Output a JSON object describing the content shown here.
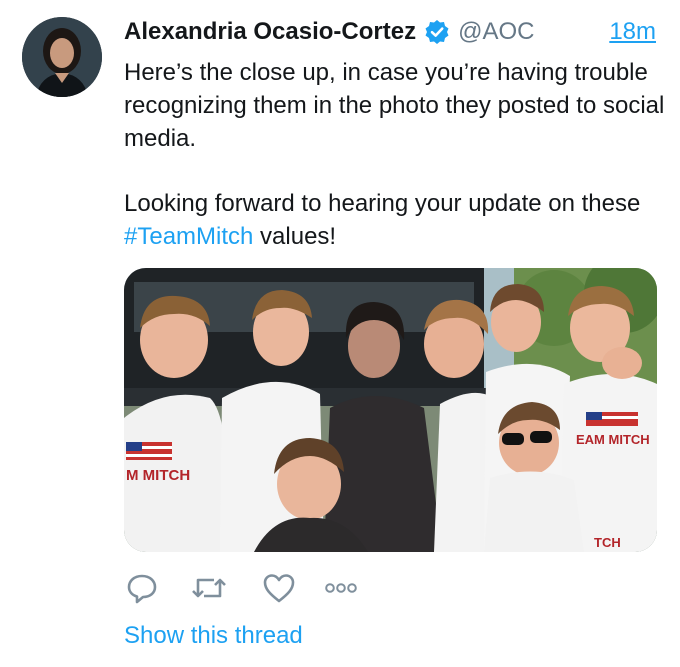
{
  "tweet": {
    "author_name": "Alexandria Ocasio-Cortez",
    "handle": "@AOC",
    "timestamp": "18m",
    "text_line1": "Here’s the close up, in case you’re having trouble recognizing them in the photo they posted to social media.",
    "text_line2_before": "Looking forward to hearing your update on these ",
    "hashtag": "#TeamMitch",
    "text_line2_after": " values!",
    "photo_shirt_text_1": "M MITCH",
    "photo_shirt_text_2": "EAM MITCH",
    "photo_shirt_text_3": "TCH"
  },
  "actions": {
    "reply_icon": "reply-icon",
    "retweet_icon": "retweet-icon",
    "like_icon": "heart-icon",
    "more_icon": "more-icon"
  },
  "show_thread_label": "Show this thread",
  "colors": {
    "accent": "#1da1f2",
    "text": "#14171a",
    "muted": "#657786",
    "icon": "#7f8f9c"
  }
}
